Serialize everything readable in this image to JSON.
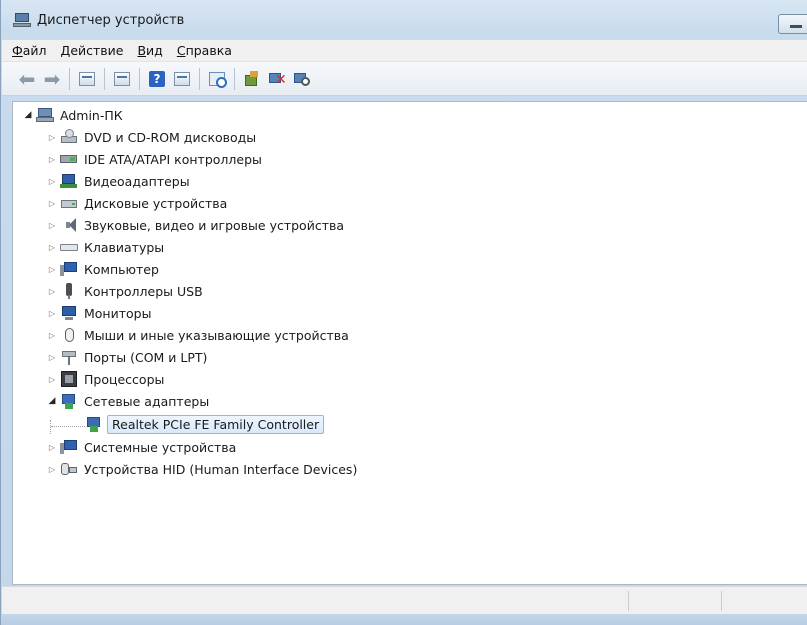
{
  "window": {
    "title": "Диспетчер устройств"
  },
  "menu": [
    {
      "key": "Ф",
      "rest": "айл"
    },
    {
      "key": "Д",
      "rest": "ействие"
    },
    {
      "key": "В",
      "rest": "ид"
    },
    {
      "key": "С",
      "rest": "правка"
    }
  ],
  "toolbar": {
    "icons": [
      "back-arrow-icon",
      "forward-arrow-icon",
      "properties-icon",
      "console-tree-icon",
      "help-icon",
      "view-icon",
      "scan-hardware-icon",
      "update-driver-icon",
      "uninstall-device-icon",
      "disable-device-icon"
    ],
    "help_glyph": "?"
  },
  "tree": {
    "root": "Admin-ПК",
    "categories": [
      "DVD и CD-ROM дисководы",
      "IDE ATA/ATAPI контроллеры",
      "Видеоадаптеры",
      "Дисковые устройства",
      "Звуковые, видео и игровые устройства",
      "Клавиатуры",
      "Компьютер",
      "Контроллеры USB",
      "Мониторы",
      "Мыши и иные указывающие устройства",
      "Порты (COM и LPT)",
      "Процессоры",
      "Сетевые адаптеры",
      "Системные устройства",
      "Устройства HID (Human Interface Devices)"
    ],
    "expanded_child": "Realtek PCIe FE Family Controller"
  }
}
